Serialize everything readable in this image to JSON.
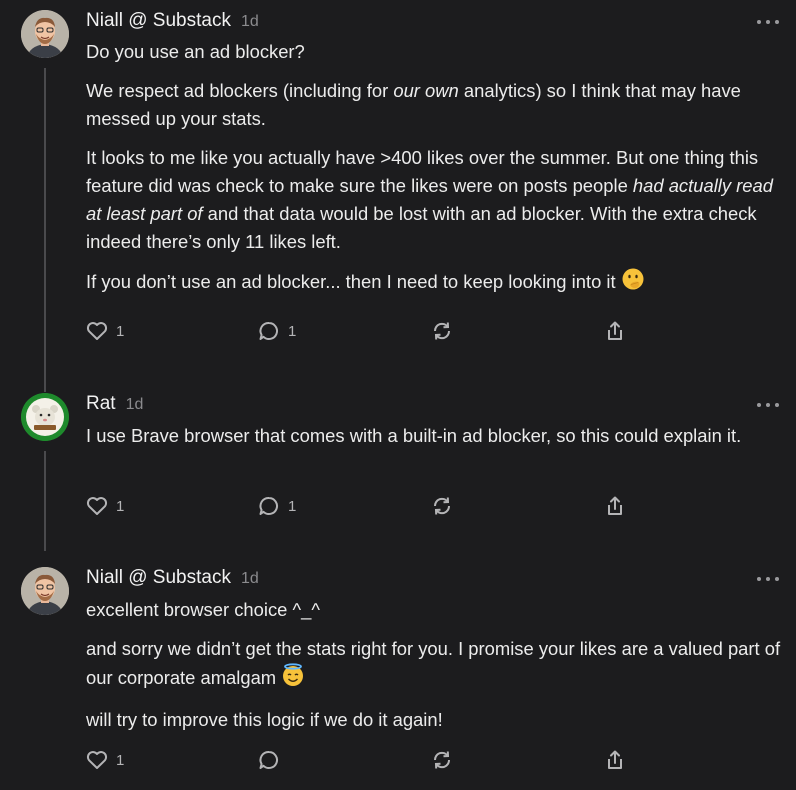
{
  "comments": [
    {
      "author": "Niall @ Substack",
      "time": "1d",
      "paragraphs": [
        "Do you use an ad blocker?",
        "We respect ad blockers (including for our own analytics) so I think that may have messed up your stats.",
        "It looks to me like you actually have >400 likes over the summer. But one thing this feature did was check to make sure the likes were on posts people had actually read at least part of and that data would be lost with an ad blocker. With the extra check indeed there’s only 11 likes left.",
        "If you don’t use an ad blocker... then I need to keep looking into it"
      ],
      "emphasis": [
        "our own",
        "had actually read at least part of"
      ],
      "trailing_emoji": "face-with-hand-over-mouth",
      "like_count": "1",
      "reply_count": "1"
    },
    {
      "author": "Rat",
      "time": "1d",
      "paragraphs": [
        "I use Brave browser that comes with a built-in ad blocker, so this could explain it."
      ],
      "like_count": "1",
      "reply_count": "1"
    },
    {
      "author": "Niall @ Substack",
      "time": "1d",
      "paragraphs": [
        "excellent browser choice ^_^",
        "and sorry we didn’t get the stats right for you. I promise your likes are a valued part of our corporate amalgam",
        "will try to improve this logic if we do it again!"
      ],
      "trailing_emoji": "smiling-face-with-halo",
      "like_count": "1",
      "reply_count": ""
    }
  ],
  "colors": {
    "background": "#1c1c1e",
    "text": "#ececec",
    "muted": "#8b8b8e",
    "icon": "#b4b4b6",
    "thread_line": "#4a4a4d",
    "rat_avatar_ring": "#1e8a2c"
  },
  "icons": [
    "heart-icon",
    "comment-icon",
    "restack-icon",
    "share-icon",
    "more-icon"
  ]
}
